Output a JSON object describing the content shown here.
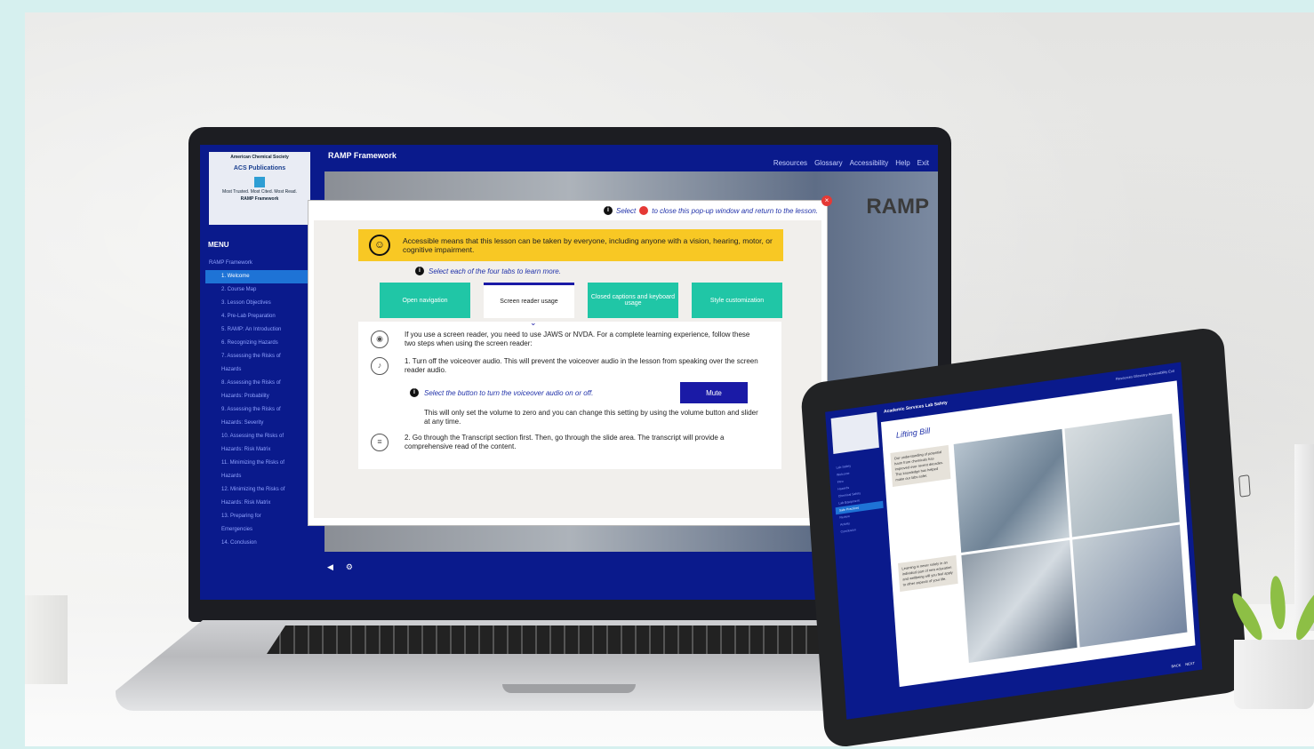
{
  "laptop": {
    "logo": {
      "org": "American Chemical Society",
      "brand": "ACS Publications",
      "tagline": "Most Trusted. Most Cited. Most Read.",
      "course": "RAMP Framework"
    },
    "app_title": "RAMP Framework",
    "top_nav": [
      "Resources",
      "Glossary",
      "Accessibility",
      "Help",
      "Exit"
    ],
    "menu_label": "MENU",
    "menu": [
      {
        "label": "RAMP Framework",
        "parent": true
      },
      {
        "label": "1. Welcome",
        "active": true
      },
      {
        "label": "2. Course Map"
      },
      {
        "label": "3. Lesson Objectives"
      },
      {
        "label": "4. Pre-Lab Preparation"
      },
      {
        "label": "5. RAMP: An Introduction"
      },
      {
        "label": "6. Recognizing Hazards"
      },
      {
        "label": "7. Assessing the Risks of"
      },
      {
        "label": "Hazards"
      },
      {
        "label": "8. Assessing the Risks of"
      },
      {
        "label": "Hazards: Probability"
      },
      {
        "label": "9. Assessing the Risks of"
      },
      {
        "label": "Hazards: Severity"
      },
      {
        "label": "10. Assessing the Risks of"
      },
      {
        "label": "Hazards: Risk Matrix"
      },
      {
        "label": "11. Minimizing the Risks of"
      },
      {
        "label": "Hazards"
      },
      {
        "label": "12. Minimizing the Risks of"
      },
      {
        "label": "Hazards: Risk Matrix"
      },
      {
        "label": "13. Preparing for"
      },
      {
        "label": "Emergencies"
      },
      {
        "label": "14. Conclusion"
      }
    ],
    "slide_watermark": "RAMP",
    "popup": {
      "close_hint_prefix": "Select",
      "close_hint_suffix": "to close this pop-up window and return to the lesson.",
      "banner": "Accessible means that this lesson can be taken by everyone, including anyone with a vision, hearing, motor, or cognitive impairment.",
      "instruction": "Select each of the four tabs to learn more.",
      "tabs": [
        {
          "label": "Open navigation"
        },
        {
          "label": "Screen reader usage",
          "active": true
        },
        {
          "label": "Closed captions and keyboard usage"
        },
        {
          "label": "Style customization"
        }
      ],
      "content": {
        "intro": "If you use a screen reader, you need to use JAWS or NVDA. For a complete learning experience, follow these two steps when using the screen reader:",
        "step1": "1.   Turn off the voiceover audio. This will prevent the voiceover audio in the lesson from speaking over the screen reader audio.",
        "step1_instruction": "Select the button to turn the voiceover audio on or off.",
        "mute_label": "Mute",
        "step1_note": "This will only set the volume to zero and you can change this setting by using the volume button and slider at any time.",
        "step2": "2.   Go through the Transcript section first. Then, go through the slide area. The transcript will provide a comprehensive read of the content."
      }
    }
  },
  "tablet": {
    "app_title": "Academic Services Lab Safety",
    "nav": "Resources   Glossary   Accessibility   Exit",
    "heading": "Lifting Bill",
    "card1": "Our understanding of potential harm from chemicals has improved over recent decades. This knowledge has helped make our labs safer.",
    "card2": "Learning is never solely in an individual part of new education and wellbeing will you feel apply to other aspects of your life.",
    "menu": [
      "Lab Safety",
      "Welcome",
      "Intro",
      "Hazards",
      "Chemical Safety",
      "Lab Equipment",
      "Safe Practices",
      "Review",
      "Activity",
      "Conclusion"
    ],
    "menu_active": 6,
    "controls": [
      "BACK",
      "NEXT"
    ]
  },
  "colors": {
    "lms_blue": "#0a1a8c",
    "tab_teal": "#20c6a6",
    "banner_yellow": "#f8c824",
    "close_red": "#e53935"
  }
}
